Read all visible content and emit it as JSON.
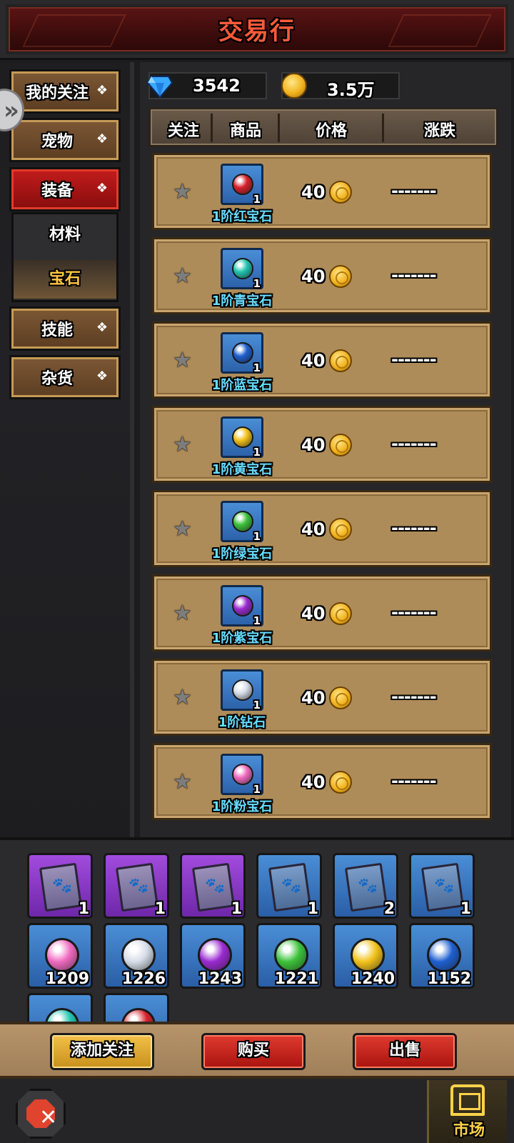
{
  "header": {
    "title": "交易行"
  },
  "sidebar": {
    "categories": [
      {
        "label": "我的关注",
        "chevron": "chevron-down"
      },
      {
        "label": "宠物",
        "chevron": "chevron-down"
      },
      {
        "label": "装备",
        "chevron": "chevron-up",
        "active": true
      },
      {
        "label": "技能",
        "chevron": "chevron-down"
      },
      {
        "label": "杂货",
        "chevron": "chevron-down"
      }
    ],
    "subcategories": [
      {
        "label": "材料"
      },
      {
        "label": "宝石",
        "selected": true
      }
    ]
  },
  "currency": {
    "diamonds": "3542",
    "gold": "3.5万"
  },
  "columns": [
    "关注",
    "商品",
    "价格",
    "涨跌"
  ],
  "items": [
    {
      "name": "1阶红宝石",
      "qty": "1",
      "price": "40",
      "change": "-------",
      "gem_color": "#d8202a"
    },
    {
      "name": "1阶青宝石",
      "qty": "1",
      "price": "40",
      "change": "-------",
      "gem_color": "#22c4b0"
    },
    {
      "name": "1阶蓝宝石",
      "qty": "1",
      "price": "40",
      "change": "-------",
      "gem_color": "#1e5fd0"
    },
    {
      "name": "1阶黄宝石",
      "qty": "1",
      "price": "40",
      "change": "-------",
      "gem_color": "#f2c21a"
    },
    {
      "name": "1阶绿宝石",
      "qty": "1",
      "price": "40",
      "change": "-------",
      "gem_color": "#3cc23a"
    },
    {
      "name": "1阶紫宝石",
      "qty": "1",
      "price": "40",
      "change": "-------",
      "gem_color": "#9a2ad0"
    },
    {
      "name": "1阶钻石",
      "qty": "1",
      "price": "40",
      "change": "-------",
      "gem_color": "#d6dde8"
    },
    {
      "name": "1阶粉宝石",
      "qty": "1",
      "price": "40",
      "change": "-------",
      "gem_color": "#f06ac0"
    }
  ],
  "inventory": [
    {
      "type": "book",
      "tier": "purple",
      "count": "1"
    },
    {
      "type": "book",
      "tier": "purple",
      "count": "1"
    },
    {
      "type": "book",
      "tier": "purple",
      "count": "1"
    },
    {
      "type": "book",
      "tier": "blue",
      "count": "1"
    },
    {
      "type": "book",
      "tier": "blue",
      "count": "2"
    },
    {
      "type": "book",
      "tier": "blue",
      "count": "1"
    },
    {
      "type": "gem",
      "tier": "blue",
      "gem_color": "#f06ac0",
      "count": "1209"
    },
    {
      "type": "gem",
      "tier": "blue",
      "gem_color": "#d6dde8",
      "count": "1226"
    },
    {
      "type": "gem",
      "tier": "blue",
      "gem_color": "#9a2ad0",
      "count": "1243"
    },
    {
      "type": "gem",
      "tier": "blue",
      "gem_color": "#3cc23a",
      "count": "1221"
    },
    {
      "type": "gem",
      "tier": "blue",
      "gem_color": "#f2c21a",
      "count": "1240"
    },
    {
      "type": "gem",
      "tier": "blue",
      "gem_color": "#1e5fd0",
      "count": "1152"
    },
    {
      "type": "gem",
      "tier": "blue",
      "gem_color": "#22c4b0",
      "count": ""
    },
    {
      "type": "gem",
      "tier": "blue",
      "gem_color": "#d8202a",
      "count": ""
    }
  ],
  "actions": {
    "follow": "添加关注",
    "buy": "购买",
    "sell": "出售"
  },
  "nav": {
    "market": "市场"
  }
}
